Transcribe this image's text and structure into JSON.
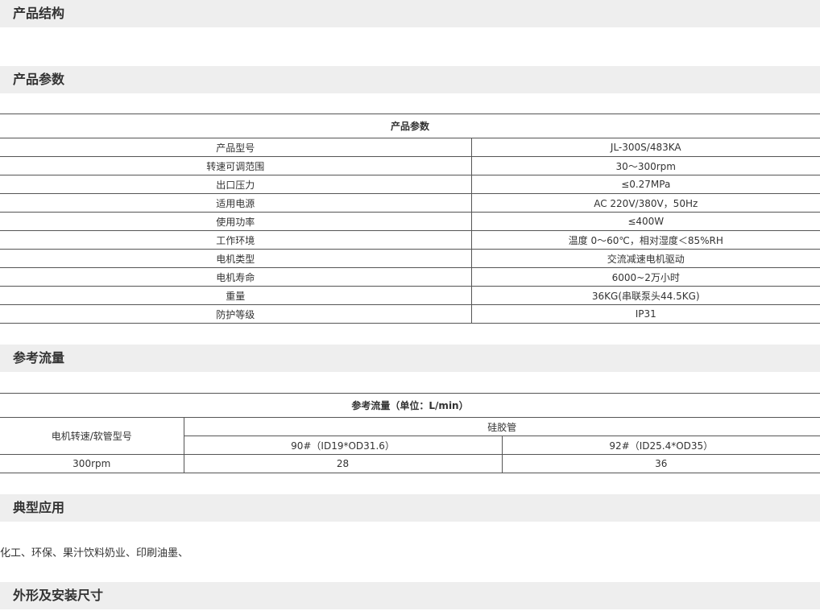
{
  "sections": {
    "structure": "产品结构",
    "params": "产品参数",
    "flow": "参考流量",
    "application": "典型应用",
    "dimensions": "外形及安装尺寸"
  },
  "params_table": {
    "title": "产品参数",
    "rows": [
      {
        "label": "产品型号",
        "value": "JL-300S/483KA"
      },
      {
        "label": "转速可调范围",
        "value": "30～300rpm"
      },
      {
        "label": "出口压力",
        "value": "≤0.27MPa"
      },
      {
        "label": "适用电源",
        "value": "AC 220V/380V，50Hz"
      },
      {
        "label": "使用功率",
        "value": "≤400W"
      },
      {
        "label": "工作环境",
        "value": "温度 0～60℃，相对湿度＜85%RH"
      },
      {
        "label": "电机类型",
        "value": "交流减速电机驱动"
      },
      {
        "label": "电机寿命",
        "value": "6000~2万小时"
      },
      {
        "label": "重量",
        "value": "36KG(串联泵头44.5KG)"
      },
      {
        "label": "防护等级",
        "value": "IP31"
      }
    ]
  },
  "flow_table": {
    "title": "参考流量（单位：L/min）",
    "row_header": "电机转速/软管型号",
    "group_header": "硅胶管",
    "columns": [
      "90#（ID19*OD31.6）",
      "92#（ID25.4*OD35）"
    ],
    "rows": [
      {
        "speed": "300rpm",
        "values": [
          "28",
          "36"
        ]
      }
    ]
  },
  "application_text": "化工、环保、果汁饮料奶业、印刷油墨、"
}
